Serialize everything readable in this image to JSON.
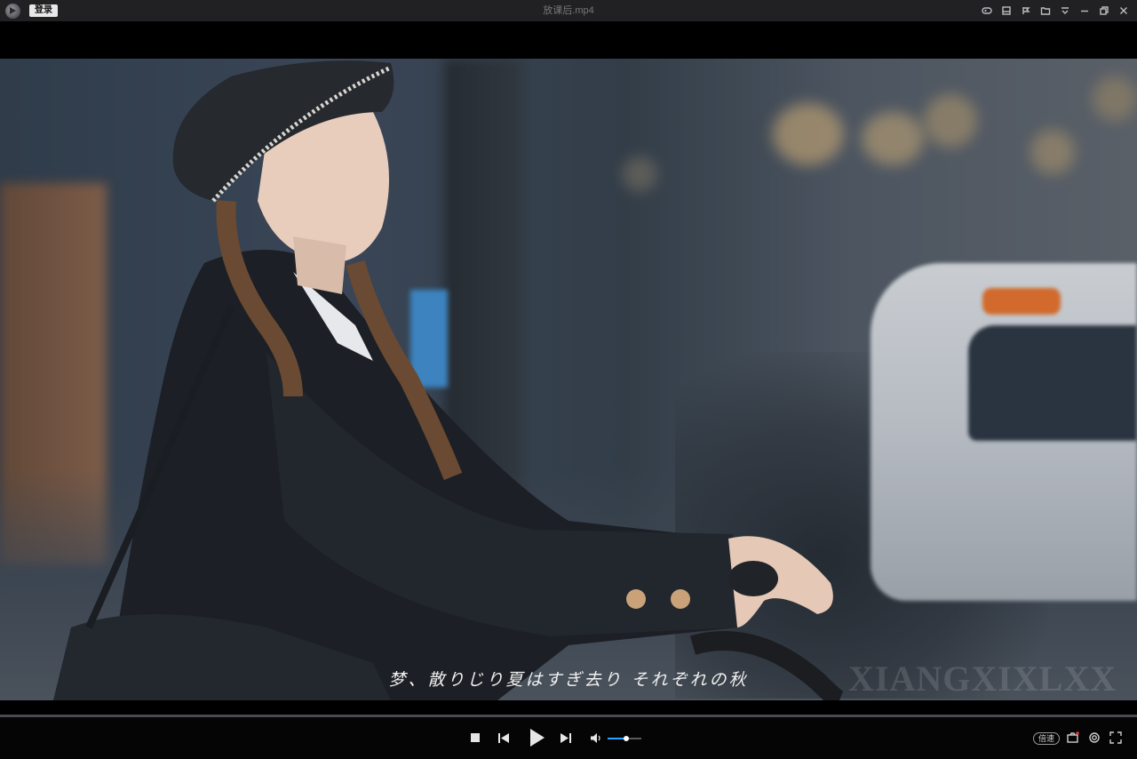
{
  "titlebar": {
    "login_label": "登录",
    "file_title": "放课后.mp4",
    "icons": [
      "gamepad-icon",
      "window-mode-icon",
      "pin-icon",
      "folder-icon",
      "menu-icon",
      "minimize-icon",
      "restore-icon",
      "close-icon"
    ]
  },
  "video": {
    "subtitle": "梦、散りじり夏はすぎ去り それぞれの秋",
    "watermark": "XIANGXIXLXX"
  },
  "playback": {
    "progress": 0.0,
    "volume": 0.55,
    "speed_label": "倍速"
  },
  "colors": {
    "accent": "#2aa3ff",
    "titlebar_bg": "#212123",
    "controls_bg": "#050505"
  }
}
